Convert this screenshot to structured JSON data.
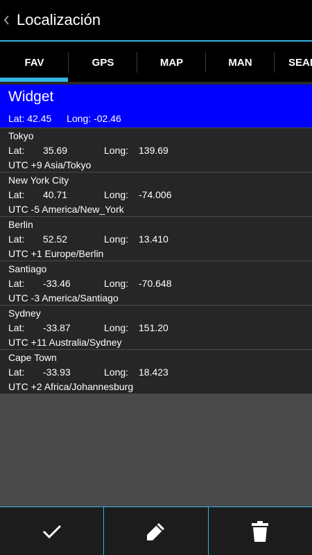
{
  "header": {
    "title": "Localización",
    "back_icon": "chevron-left-icon"
  },
  "tabs": [
    {
      "label": "FAV",
      "selected": true
    },
    {
      "label": "GPS",
      "selected": false
    },
    {
      "label": "MAP",
      "selected": false
    },
    {
      "label": "MAN",
      "selected": false
    },
    {
      "label": "SEAR",
      "selected": false
    }
  ],
  "widget": {
    "title": "Widget",
    "lat": "Lat: 42.45",
    "long": "Long: -02.46"
  },
  "labels": {
    "lat": "Lat:",
    "long": "Long:"
  },
  "locations": [
    {
      "name": "Tokyo",
      "lat": "35.69",
      "long": "139.69",
      "tz": "UTC +9   Asia/Tokyo"
    },
    {
      "name": "New York City",
      "lat": "40.71",
      "long": "-74.006",
      "tz": "UTC -5   America/New_York"
    },
    {
      "name": "Berlin",
      "lat": "52.52",
      "long": "13.410",
      "tz": "UTC +1   Europe/Berlin"
    },
    {
      "name": "Santiago",
      "lat": "-33.46",
      "long": "-70.648",
      "tz": "UTC -3   America/Santiago"
    },
    {
      "name": "Sydney",
      "lat": "-33.87",
      "long": "151.20",
      "tz": "UTC +11   Australia/Sydney"
    },
    {
      "name": "Cape Town",
      "lat": "-33.93",
      "long": "18.423",
      "tz": "UTC +2   Africa/Johannesburg"
    }
  ],
  "bottom_actions": [
    {
      "icon": "check-icon"
    },
    {
      "icon": "pencil-icon"
    },
    {
      "icon": "trash-icon"
    }
  ],
  "colors": {
    "accent": "#33b5e5",
    "selected_item": "#0000ff",
    "item_bg": "#262626"
  }
}
